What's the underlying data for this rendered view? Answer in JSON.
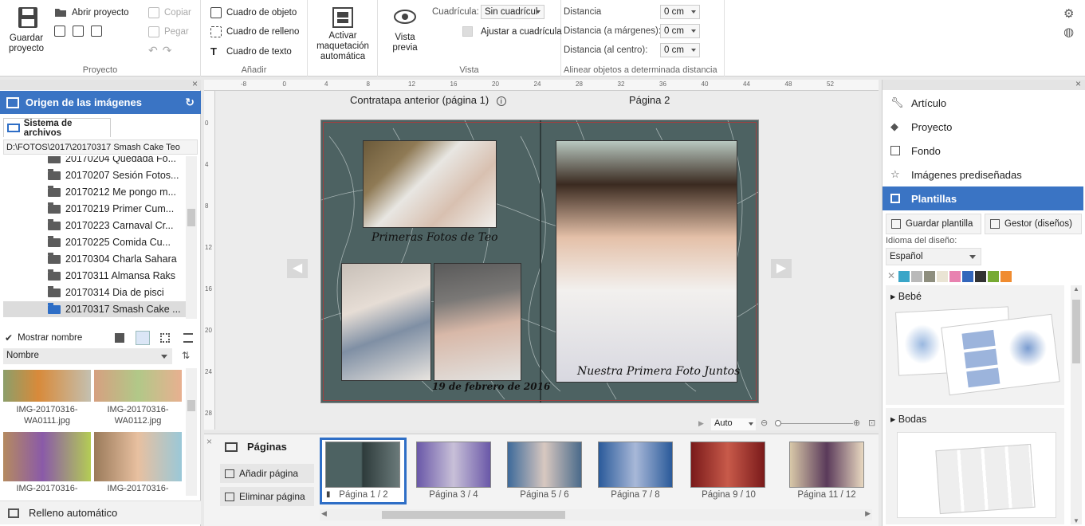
{
  "ribbon": {
    "proyecto": {
      "label": "Proyecto",
      "save": "Guardar proyecto",
      "open": "Abrir proyecto",
      "copy": "Copiar",
      "paste": "Pegar"
    },
    "anadir": {
      "label": "Añadir",
      "object_box": "Cuadro de objeto",
      "fill_box": "Cuadro de relleno",
      "text_box": "Cuadro de texto"
    },
    "layout": {
      "activate": "Activar maquetación automática"
    },
    "vista": {
      "label": "Vista",
      "preview": "Vista previa",
      "grid_label": "Cuadrícula:",
      "grid_value": "Sin cuadrícul",
      "snap": "Ajustar a cuadrícula"
    },
    "align": {
      "label": "Alinear objetos a determinada distancia",
      "distance": "Distancia",
      "distance_margins": "Distancia (a márgenes):",
      "distance_center": "Distancia (al centro):",
      "v1": "0 cm",
      "v2": "0 cm",
      "v3": "0 cm"
    }
  },
  "left": {
    "title": "Origen de las imágenes",
    "tab": "Sistema de archivos",
    "path": "D:\\FOTOS\\2017\\20170317 Smash Cake Teo",
    "folders": [
      "20170204 Quedada Fo...",
      "20170207 Sesión Fotos...",
      "20170212 Me pongo m...",
      "20170219 Primer Cum...",
      "20170223 Carnaval Cr...",
      "20170225 Comida Cu...",
      "20170304 Charla Sahara",
      "20170311 Almansa  Raks",
      "20170314 Dia de pisci",
      "20170317 Smash Cake ..."
    ],
    "show_name": "Mostrar nombre",
    "sort": "Nombre",
    "thumbs": [
      {
        "l1": "IMG-20170316-",
        "l2": "WA0111.jpg"
      },
      {
        "l1": "IMG-20170316-",
        "l2": "WA0112.jpg"
      },
      {
        "l1": "IMG-20170316-",
        "l2": ""
      },
      {
        "l1": "IMG-20170316-",
        "l2": ""
      }
    ],
    "autofill": "Relleno automático"
  },
  "canvas": {
    "left_title": "Contratapa anterior (página 1)",
    "right_title": "Página 2",
    "text1": "Primeras Fotos de Teo",
    "text2": "19 de febrero de 2016",
    "text3": "Nuestra Primera Foto Juntos",
    "zoom": "Auto",
    "ruler_top": [
      "-8",
      "0",
      "4",
      "8",
      "12",
      "16",
      "20",
      "24",
      "28",
      "32",
      "36",
      "40",
      "44",
      "48",
      "52"
    ],
    "ruler_left": [
      "0",
      "4",
      "8",
      "12",
      "16",
      "20",
      "24",
      "28"
    ]
  },
  "pages": {
    "title": "Páginas",
    "add": "Añadir página",
    "remove": "Eliminar página",
    "items": [
      "Página 1 / 2",
      "Página 3 / 4",
      "Página 5 / 6",
      "Página 7 / 8",
      "Página 9 / 10",
      "Página 11 / 12"
    ]
  },
  "right": {
    "items": [
      "Artículo",
      "Proyecto",
      "Fondo",
      "Imágenes prediseñadas",
      "Plantillas"
    ],
    "save_template": "Guardar plantilla",
    "manager": "Gestor (diseños)",
    "lang_label": "Idioma del diseño:",
    "lang_value": "Español",
    "cat1": "Bebé",
    "cat2": "Bodas",
    "swatches": [
      "#3aa6c8",
      "#b9b9b9",
      "#8e8e7e",
      "#eae4d4",
      "#e882b0",
      "#3366bb",
      "#333333",
      "#77aa33",
      "#f08c30"
    ]
  }
}
